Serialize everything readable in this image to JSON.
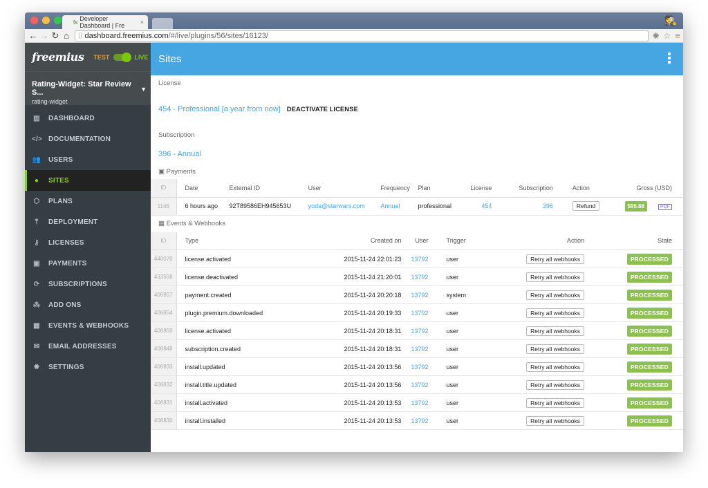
{
  "browser": {
    "tab_title": "Developer Dashboard | Fre",
    "url_host": "dashboard.freemius.com",
    "url_path": "/#/live/plugins/56/sites/16123/"
  },
  "sidebar": {
    "logo": "freemius",
    "test_label": "TEST",
    "live_label": "LIVE",
    "mode": "live",
    "plugin_name": "Rating-Widget: Star Review S...",
    "plugin_slug": "rating-widget",
    "items": [
      {
        "label": "DASHBOARD",
        "icon": "▥",
        "icon_name": "bar-chart-icon",
        "active": false
      },
      {
        "label": "DOCUMENTATION",
        "icon": "</>",
        "icon_name": "code-icon",
        "active": false
      },
      {
        "label": "USERS",
        "icon": "👥",
        "icon_name": "users-icon",
        "active": false
      },
      {
        "label": "SITES",
        "icon": "●",
        "icon_name": "globe-icon",
        "active": true
      },
      {
        "label": "PLANS",
        "icon": "⬡",
        "icon_name": "dropbox-icon",
        "active": false
      },
      {
        "label": "DEPLOYMENT",
        "icon": "⤒",
        "icon_name": "upload-icon",
        "active": false
      },
      {
        "label": "LICENSES",
        "icon": "⚷",
        "icon_name": "key-icon",
        "active": false
      },
      {
        "label": "PAYMENTS",
        "icon": "▣",
        "icon_name": "money-icon",
        "active": false
      },
      {
        "label": "SUBSCRIPTIONS",
        "icon": "⟳",
        "icon_name": "refresh-icon",
        "active": false
      },
      {
        "label": "ADD ONS",
        "icon": "⁂",
        "icon_name": "cubes-icon",
        "active": false
      },
      {
        "label": "EVENTS & WEBHOOKS",
        "icon": "▦",
        "icon_name": "calendar-icon",
        "active": false
      },
      {
        "label": "EMAIL ADDRESSES",
        "icon": "✉",
        "icon_name": "envelope-icon",
        "active": false
      },
      {
        "label": "SETTINGS",
        "icon": "✹",
        "icon_name": "gear-icon",
        "active": false
      }
    ]
  },
  "main": {
    "title": "Sites",
    "license_label": "License",
    "license_link": "454 - Professional [a year from now]",
    "deactivate_label": "DEACTIVATE LICENSE",
    "subscription_label": "Subscription",
    "subscription_link": "396 - Annual",
    "payments_label": "Payments",
    "payments": {
      "headers": [
        "ID",
        "Date",
        "External ID",
        "User",
        "Frequency",
        "Plan",
        "License",
        "Subscription",
        "Action",
        "Gross (USD)"
      ],
      "rows": [
        {
          "id": "1146",
          "date": "6 hours ago",
          "external_id": "92T89586EH945653U",
          "user": "yoda@starwars.com",
          "frequency": "Annual",
          "plan": "professional",
          "license": "454",
          "subscription": "396",
          "action": "Refund",
          "gross": "$95.88"
        }
      ]
    },
    "events_label": "Events & Webhooks",
    "events": {
      "headers": [
        "ID",
        "Type",
        "Created on",
        "User",
        "Trigger",
        "Action",
        "State"
      ],
      "rows": [
        {
          "id": "440070",
          "type": "license.activated",
          "created": "2015-11-24 22:01:23",
          "user": "13792",
          "trigger": "user",
          "action": "Retry all webhooks",
          "state": "PROCESSED"
        },
        {
          "id": "433558",
          "type": "license.deactivated",
          "created": "2015-11-24 21:20:01",
          "user": "13792",
          "trigger": "user",
          "action": "Retry all webhooks",
          "state": "PROCESSED"
        },
        {
          "id": "406857",
          "type": "payment.created",
          "created": "2015-11-24 20:20:18",
          "user": "13792",
          "trigger": "system",
          "action": "Retry all webhooks",
          "state": "PROCESSED"
        },
        {
          "id": "406854",
          "type": "plugin.premium.downloaded",
          "created": "2015-11-24 20:19:33",
          "user": "13792",
          "trigger": "user",
          "action": "Retry all webhooks",
          "state": "PROCESSED"
        },
        {
          "id": "406850",
          "type": "license.activated",
          "created": "2015-11-24 20:18:31",
          "user": "13792",
          "trigger": "user",
          "action": "Retry all webhooks",
          "state": "PROCESSED"
        },
        {
          "id": "406848",
          "type": "subscription.created",
          "created": "2015-11-24 20:18:31",
          "user": "13792",
          "trigger": "user",
          "action": "Retry all webhooks",
          "state": "PROCESSED"
        },
        {
          "id": "406833",
          "type": "install.updated",
          "created": "2015-11-24 20:13:56",
          "user": "13792",
          "trigger": "user",
          "action": "Retry all webhooks",
          "state": "PROCESSED"
        },
        {
          "id": "406832",
          "type": "install.title.updated",
          "created": "2015-11-24 20:13:56",
          "user": "13792",
          "trigger": "user",
          "action": "Retry all webhooks",
          "state": "PROCESSED"
        },
        {
          "id": "406831",
          "type": "install.activated",
          "created": "2015-11-24 20:13:53",
          "user": "13792",
          "trigger": "user",
          "action": "Retry all webhooks",
          "state": "PROCESSED"
        },
        {
          "id": "406830",
          "type": "install.installed",
          "created": "2015-11-24 20:13:53",
          "user": "13792",
          "trigger": "user",
          "action": "Retry all webhooks",
          "state": "PROCESSED"
        }
      ]
    }
  },
  "colors": {
    "accent": "#45a6e1",
    "active": "#87d21c",
    "success": "#8cc152",
    "sidebar": "#363d44"
  }
}
